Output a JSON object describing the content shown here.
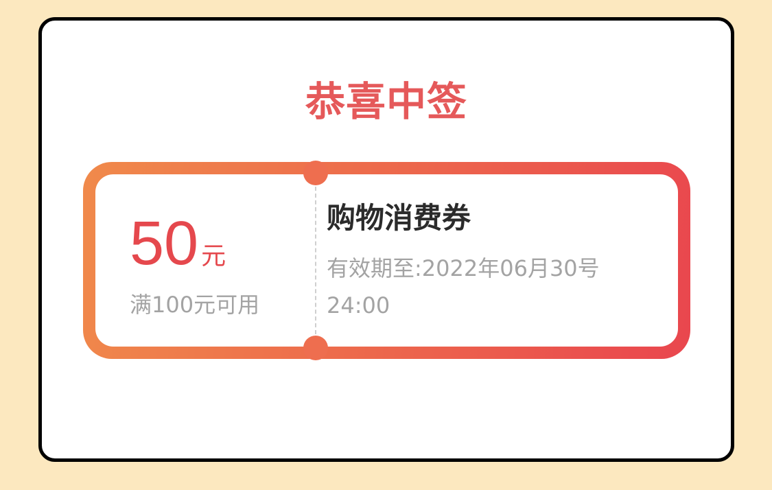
{
  "dialog": {
    "title": "恭喜中签"
  },
  "coupon": {
    "amount": "50",
    "unit": "元",
    "condition": "满100元可用",
    "name": "购物消费券",
    "validity": "有效期至:2022年06月30号24:00"
  },
  "colors": {
    "page_background": "#FCE8BF",
    "title": "#E5595A",
    "amount": "#E5484D",
    "coupon_gradient_start": "#F08A4B",
    "coupon_gradient_end": "#E9464E",
    "muted_text": "#A3A3A3",
    "name_text": "#2B2B2B"
  }
}
